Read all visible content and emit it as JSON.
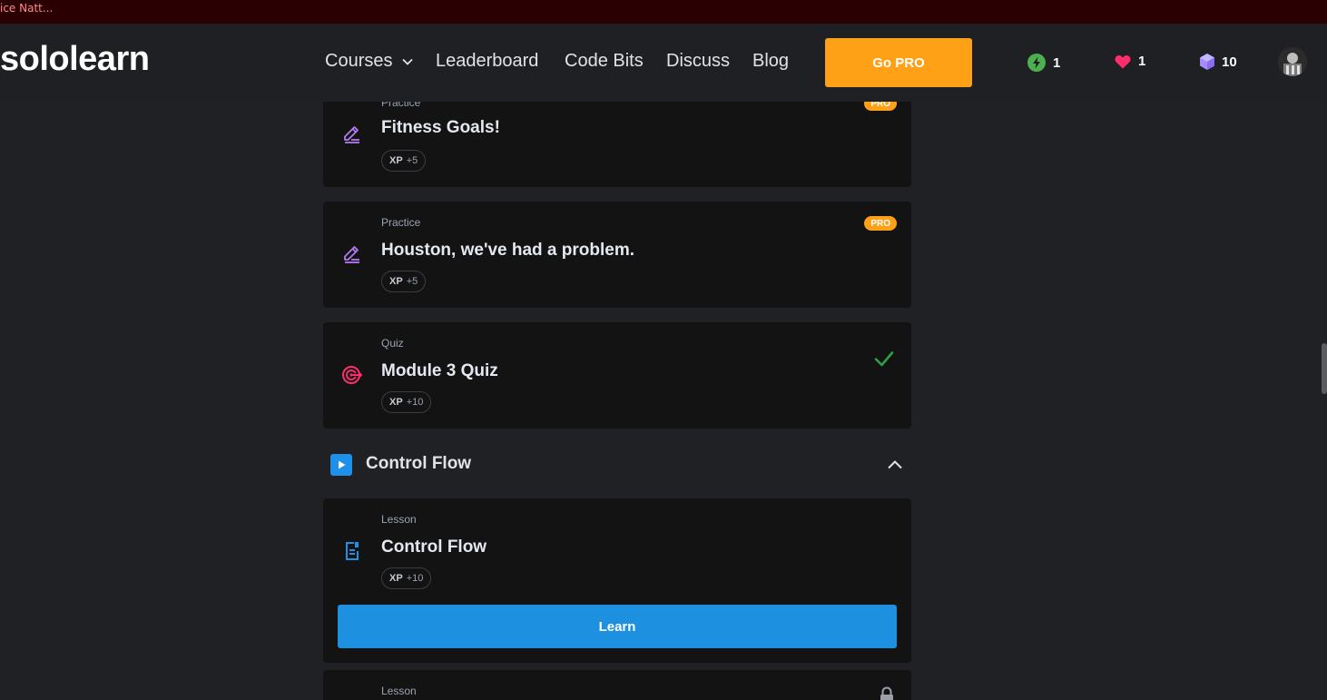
{
  "browser": {
    "tab_fragment": "ice Natt..."
  },
  "header": {
    "logo": "sololearn",
    "nav": {
      "courses": "Courses",
      "leaderboard": "Leaderboard",
      "code_bits": "Code Bits",
      "discuss": "Discuss",
      "blog": "Blog"
    },
    "go_pro": "Go PRO",
    "stats": {
      "streak": "1",
      "hearts": "1",
      "gems": "10"
    },
    "colors": {
      "accent": "#ffa116",
      "streak": "#4caf50",
      "heart": "#ff2d6b",
      "gem": "#a78bfa"
    }
  },
  "cards": [
    {
      "type": "Practice",
      "title": "Fitness Goals!",
      "xp_label": "XP",
      "xp_value": "+5",
      "badge": "PRO",
      "icon": "pencil-icon"
    },
    {
      "type": "Practice",
      "title": "Houston, we've had a problem.",
      "xp_label": "XP",
      "xp_value": "+5",
      "badge": "PRO",
      "icon": "pencil-icon"
    },
    {
      "type": "Quiz",
      "title": "Module 3 Quiz",
      "xp_label": "XP",
      "xp_value": "+10",
      "status": "completed",
      "icon": "target-icon"
    }
  ],
  "section": {
    "title": "Control Flow",
    "expanded": true
  },
  "section_cards": [
    {
      "type": "Lesson",
      "title": "Control Flow",
      "xp_label": "XP",
      "xp_value": "+10",
      "button": "Learn",
      "icon": "lesson-doc-icon"
    },
    {
      "type": "Lesson",
      "status": "locked"
    }
  ]
}
